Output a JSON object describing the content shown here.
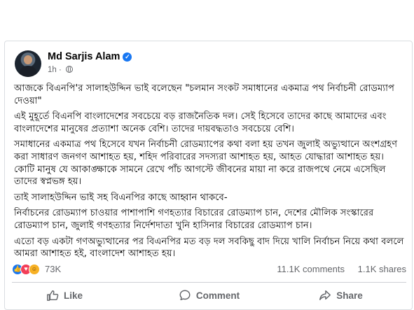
{
  "post": {
    "author": "Md Sarjis Alam",
    "time": "1h",
    "time_separator": "·",
    "verified_glyph": "✓",
    "paragraphs": [
      "আজকে বিএনপি'র সালাহউদ্দিন ভাই বলেছেন \"চলমান সংকট সমাধানের একমাত্র পথ নির্বাচনী রোডম্যাপ দেওয়া\"",
      "এই মুহূর্তে বিএনপি বাংলাদেশের সবচেয়ে বড় রাজনৈতিক দল। সেই হিসেবে তাদের কাছে আমাদের এবং বাংলাদেশের মানুষের প্রত্যাশা অনেক বেশি। তাদের দায়বদ্ধতাও সবচেয়ে বেশি।",
      "সমাধানের একমাত্র পথ হিসেবে যখন নির্বাচনী রোডম্যাপের কথা বলা হয় তখন জুলাই অভ্যুত্থানে অংশগ্রহণ করা সাধারণ জনগণ আশাহত হয়, শহিদ পরিবারের সদস্যরা আশাহত হয়, আহত যোদ্ধারা আশাহত হয়। কোটি মানুষ যে আকাঙ্ক্ষাকে সামনে রেখে পাঁচ আগস্টে জীবনের মায়া না করে রাজপথে নেমে এসেছিল তাদের স্বপ্নভঙ্গ হয়।",
      "তাই সালাহউদ্দিন ভাই সহ বিএনপির কাছে আহ্বান থাকবে-",
      "নির্বাচনের রোডম্যাপ চাওয়ার পাশাপাশি গণহত্যার বিচারের রোডম্যাপ চান, দেশের মৌলিক সংস্কারের রোডম্যাপ চান, জুলাই গণহত্যার নির্দেশদাতা খুনি হাসিনার বিচারের রোডম্যাপ চান।",
      "এতো বড় একটা গণঅভ্যুত্থানের পর বিএনপির মত বড় দল সবকিছু বাদ দিয়ে খালি নির্বাচন নিয়ে কথা বললে আমরা আশাহত হই, বাংলাদেশ আশাহত হয়।"
    ]
  },
  "stats": {
    "reactions": "73K",
    "comments": "11.1K comments",
    "shares": "1.1K shares",
    "reaction_icons": [
      "like-reaction-icon",
      "love-reaction-icon",
      "haha-reaction-icon"
    ]
  },
  "actions": {
    "like": "Like",
    "comment": "Comment",
    "share": "Share"
  },
  "colors": {
    "accent": "#1877f2",
    "love": "#f33e58",
    "haha": "#f7b125",
    "muted_text": "#65676b",
    "border": "#dadde1"
  }
}
